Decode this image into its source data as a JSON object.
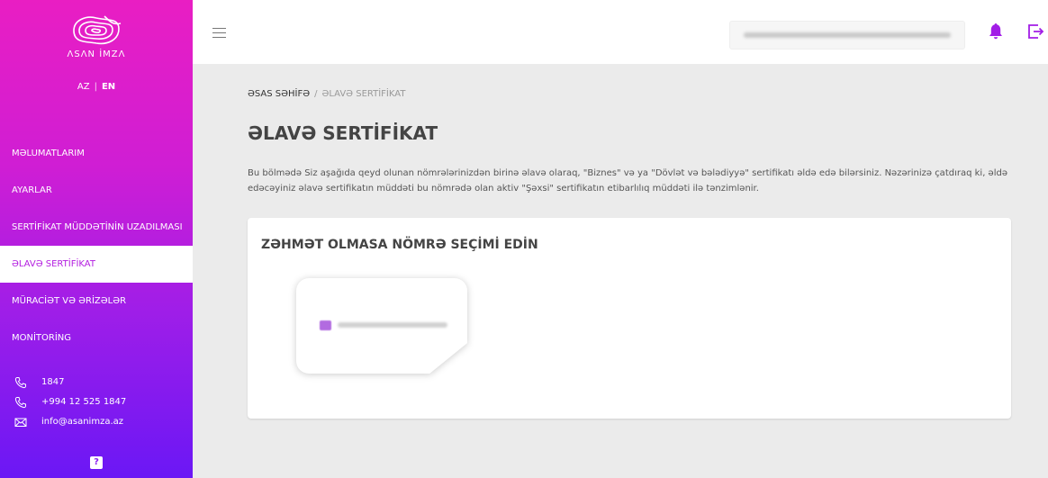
{
  "sidebar": {
    "logo_text": "ΛSΛN İMZΛ",
    "lang": {
      "az": "AZ",
      "separator": "|",
      "en": "EN",
      "active": "EN"
    },
    "items": [
      {
        "label": "MƏLUMATLARIM"
      },
      {
        "label": "AYARLAR"
      },
      {
        "label": "SERTİFİKAT MÜDDƏTİNİN UZADILMASI"
      },
      {
        "label": "ƏLAVƏ SERTİFİKAT",
        "active": true
      },
      {
        "label": "MÜRACİƏT VƏ ƏRİZƏLƏR"
      },
      {
        "label": "MONİTORİNG"
      }
    ],
    "contacts": [
      {
        "icon": "phone-icon",
        "text": "1847"
      },
      {
        "icon": "phone-icon",
        "text": "+994 12 525 1847"
      },
      {
        "icon": "mail-icon",
        "text": "info@asanimza.az"
      }
    ],
    "help_label": "?"
  },
  "topbar": {
    "icons": [
      "menu-icon",
      "bell-icon",
      "logout-icon"
    ]
  },
  "breadcrumb": {
    "home": "ƏSAS SƏHİFƏ",
    "separator": "/",
    "current": "ƏLAVƏ SERTİFİKAT"
  },
  "page": {
    "title": "ƏLAVƏ SERTİFİKAT",
    "description": "Bu bölmədə Siz aşağıda qeyd olunan nömrələrinizdən birinə əlavə olaraq, \"Biznes\" və ya \"Dövlət və bələdiyyə\" sertifikatı əldə edə bilərsiniz. Nəzərinizə çatdıraq ki, əldə edəcəyiniz əlavə sertifikatın müddəti bu nömrədə olan aktiv \"Şəxsi\" sertifikatın etibarlılıq müddəti ilə tənzimlənir."
  },
  "card": {
    "title": "ZƏHMƏT OLMASA NÖMRƏ SEÇİMİ EDİN"
  },
  "colors": {
    "accent": "#b31de0",
    "gradient_top": "#e91ec3",
    "gradient_bottom": "#6b17f5",
    "bell": "#a21de6"
  }
}
